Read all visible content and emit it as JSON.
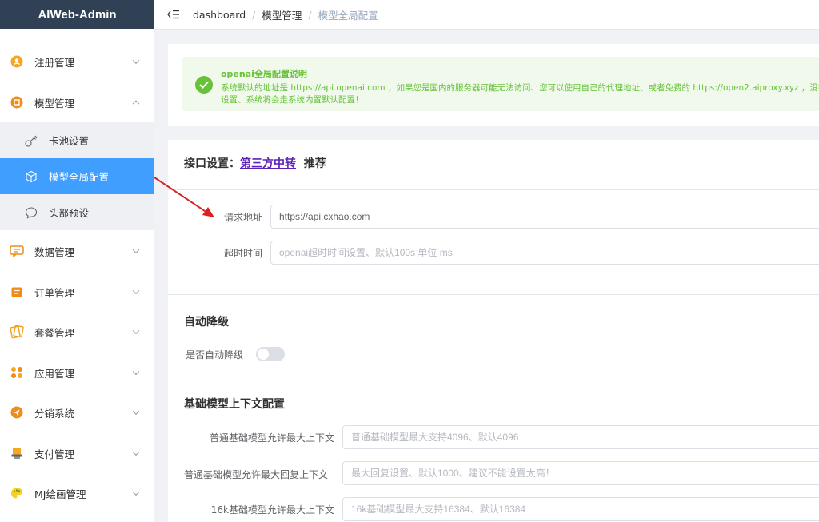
{
  "app": {
    "title": "AIWeb-Admin"
  },
  "sidebar": {
    "items": [
      {
        "label": "注册管理",
        "icon": "user-icon"
      },
      {
        "label": "模型管理",
        "icon": "model-icon"
      },
      {
        "label": "数据管理",
        "icon": "chat-data-icon"
      },
      {
        "label": "订单管理",
        "icon": "order-icon"
      },
      {
        "label": "套餐管理",
        "icon": "package-icon"
      },
      {
        "label": "应用管理",
        "icon": "apps-icon"
      },
      {
        "label": "分销系统",
        "icon": "distribution-icon"
      },
      {
        "label": "支付管理",
        "icon": "payment-icon"
      },
      {
        "label": "MJ绘画管理",
        "icon": "palette-icon"
      }
    ],
    "sub_items": [
      {
        "label": "卡池设置",
        "icon": "key-icon"
      },
      {
        "label": "模型全局配置",
        "icon": "cube-icon"
      },
      {
        "label": "头部预设",
        "icon": "bubble-icon"
      }
    ]
  },
  "breadcrumb": {
    "items": [
      "dashboard",
      "模型管理",
      "模型全局配置"
    ]
  },
  "alert": {
    "title": "openai全局配置说明",
    "desc": "系统默认的地址是 https://api.openai.com ，如果您是国内的服务器可能无法访问、您可以使用自己的代理地址、或者免费的 https://open2.aiproxy.xyz ，没有设置、系统将会走系统内置默认配置！"
  },
  "interface": {
    "title_prefix": "接口设置：",
    "link": "第三方中转",
    "title_suffix": "推荐",
    "url_label": "请求地址",
    "url_value": "https://api.cxhao.com",
    "timeout_label": "超时时间",
    "timeout_placeholder": "openai超时时间设置、默认100s 单位 ms"
  },
  "downgrade": {
    "title": "自动降级",
    "switch_label": "是否自动降级",
    "enabled": false
  },
  "context": {
    "title": "基础模型上下文配置",
    "fields": [
      {
        "label": "普通基础模型允许最大上下文",
        "placeholder": "普通基础模型最大支持4096、默认4096"
      },
      {
        "label": "普通基础模型允许最大回复上下文",
        "placeholder": "最大回复设置、默认1000、建议不能设置太高！"
      },
      {
        "label": "16k基础模型允许最大上下文",
        "placeholder": "16k基础模型最大支持16384、默认16384"
      }
    ]
  },
  "colors": {
    "primary": "#409eff",
    "success": "#67c23a",
    "sidebar_header": "#304156",
    "annotation_arrow": "#e02020"
  }
}
